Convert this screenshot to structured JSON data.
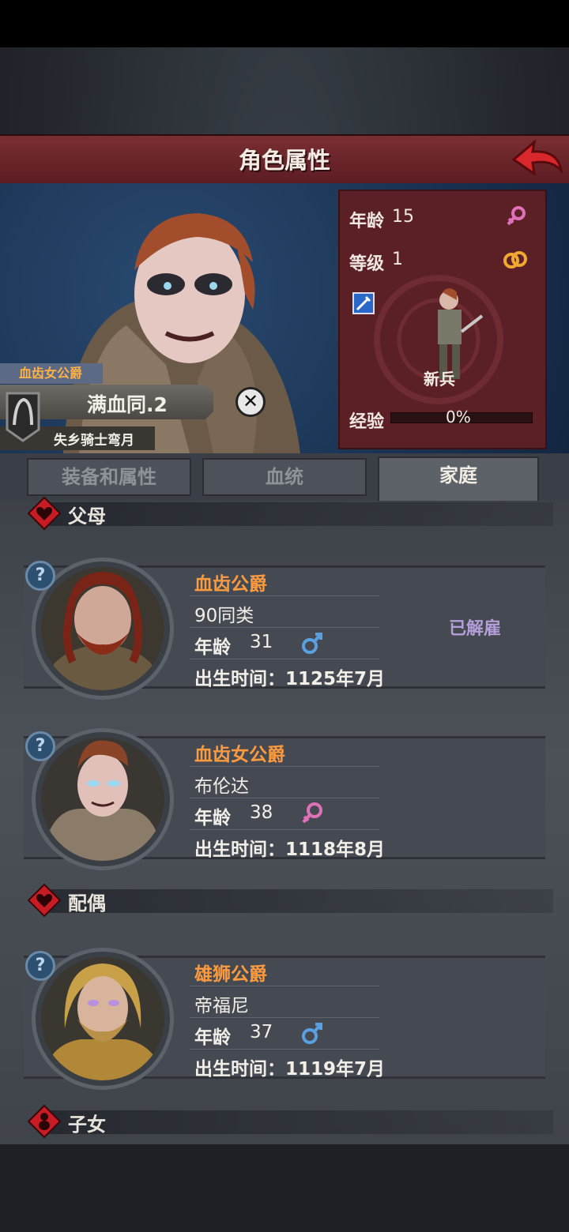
{
  "header": {
    "title": "角色属性"
  },
  "character": {
    "title_tag": "血齿女公爵",
    "name": "满血同.2",
    "subtitle": "失乡骑士弯月",
    "age_label": "年龄",
    "age": "15",
    "level_label": "等级",
    "level": "1",
    "class_name": "新兵",
    "exp_label": "经验",
    "exp_percent": "0%",
    "exp_fraction": 0
  },
  "tabs": [
    {
      "label": "装备和属性",
      "active": false
    },
    {
      "label": "血统",
      "active": false
    },
    {
      "label": "家庭",
      "active": true
    }
  ],
  "family": {
    "parents_label": "父母",
    "spouse_label": "配偶",
    "children_label": "子女",
    "parents": [
      {
        "title": "血齿公爵",
        "name": "90同类",
        "age_label": "年龄",
        "age": "31",
        "gender": "male",
        "birth": "出生时间：1125年7月",
        "status": "已解雇"
      },
      {
        "title": "血齿女公爵",
        "name": "布伦达",
        "age_label": "年龄",
        "age": "38",
        "gender": "female",
        "birth": "出生时间：1118年8月"
      }
    ],
    "spouse": [
      {
        "title": "雄狮公爵",
        "name": "帝福尼",
        "age_label": "年龄",
        "age": "37",
        "gender": "male",
        "birth": "出生时间：1119年7月"
      }
    ]
  },
  "colors": {
    "accent_orange": "#ff9a3e",
    "title_bar": "#6a2428",
    "female": "#e070b8",
    "male": "#5aa0e0"
  }
}
